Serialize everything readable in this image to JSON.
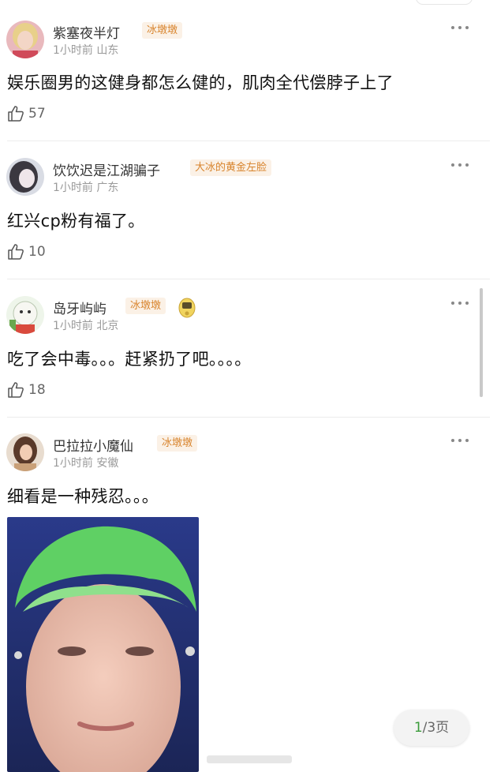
{
  "comments": [
    {
      "username": "紫塞夜半灯",
      "badge": "冰墩墩",
      "time": "1小时前",
      "location": "山东",
      "text": "娱乐圈男的这健身都怎么健的，肌肉全代偿脖子上了",
      "likes": "57",
      "avatar_icon": "blonde-woman-avatar"
    },
    {
      "username": "饮饮迟是江湖骗子",
      "badge": "大冰的黄金左脸",
      "time": "1小时前",
      "location": "广东",
      "text": "红兴cp粉有福了。",
      "likes": "10",
      "avatar_icon": "dark-hair-avatar"
    },
    {
      "username": "岛牙屿屿",
      "badge": "冰墩墩",
      "time": "1小时前",
      "location": "北京",
      "text": "吃了会中毒。。。赶紧扔了吧。。。。",
      "likes": "18",
      "avatar_icon": "cartoon-avatar"
    },
    {
      "username": "巴拉拉小魔仙",
      "badge": "冰墩墩",
      "time": "1小时前",
      "location": "安徽",
      "text": "细看是一种残忍。。。",
      "avatar_icon": "girl-avatar"
    }
  ],
  "pager": {
    "current": "1",
    "total": "/3页"
  },
  "colors": {
    "badge_bg": "#fbf1e6",
    "badge_text": "#d8842d",
    "pager_current": "#3a9b3a"
  }
}
